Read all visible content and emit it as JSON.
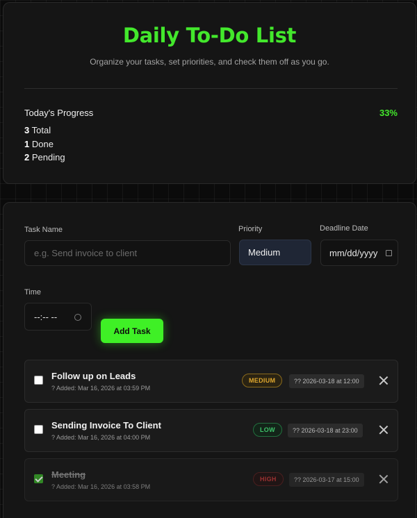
{
  "header": {
    "title": "Daily To-Do List",
    "subtitle": "Organize your tasks, set priorities, and check them off as you go."
  },
  "progress": {
    "label": "Today's Progress",
    "percent": "33%",
    "total_count": "3",
    "total_label": "Total",
    "done_count": "1",
    "done_label": "Done",
    "pending_count": "2",
    "pending_label": "Pending"
  },
  "form": {
    "task_name_label": "Task Name",
    "task_name_placeholder": "e.g. Send invoice to client",
    "priority_label": "Priority",
    "priority_value": "Medium",
    "deadline_label": "Deadline Date",
    "deadline_value": "mm/dd/yyyy",
    "time_label": "Time",
    "time_value": "--:-- --",
    "add_button": "Add Task"
  },
  "tasks": [
    {
      "name": "Follow up on Leads",
      "added": "? Added: Mar 16, 2026 at 03:59 PM",
      "priority": "MEDIUM",
      "deadline": "?? 2026-03-18 at 12:00",
      "done": false
    },
    {
      "name": "Sending Invoice To Client",
      "added": "? Added: Mar 16, 2026 at 04:00 PM",
      "priority": "LOW",
      "deadline": "?? 2026-03-18 at 23:00",
      "done": false
    },
    {
      "name": "Meeting",
      "added": "? Added: Mar 16, 2026 at 03:58 PM",
      "priority": "HIGH",
      "deadline": "?? 2026-03-17 at 15:00",
      "done": true
    }
  ],
  "colors": {
    "accent": "#43e82c",
    "medium": "#e0a82e",
    "low": "#3ec46a",
    "high": "#c13a3a"
  }
}
